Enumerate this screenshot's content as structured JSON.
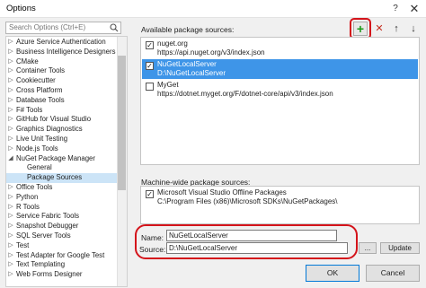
{
  "window": {
    "title": "Options",
    "help_label": "?",
    "close_label": "✕"
  },
  "search": {
    "placeholder": "Search Options (Ctrl+E)"
  },
  "tree": {
    "items": [
      {
        "label": "Azure Service Authentication",
        "expandable": true,
        "level": 0,
        "selected": false
      },
      {
        "label": "Business Intelligence Designers",
        "expandable": true,
        "level": 0,
        "selected": false
      },
      {
        "label": "CMake",
        "expandable": true,
        "level": 0,
        "selected": false
      },
      {
        "label": "Container Tools",
        "expandable": true,
        "level": 0,
        "selected": false
      },
      {
        "label": "Cookiecutter",
        "expandable": true,
        "level": 0,
        "selected": false
      },
      {
        "label": "Cross Platform",
        "expandable": true,
        "level": 0,
        "selected": false
      },
      {
        "label": "Database Tools",
        "expandable": true,
        "level": 0,
        "selected": false
      },
      {
        "label": "F# Tools",
        "expandable": true,
        "level": 0,
        "selected": false
      },
      {
        "label": "GitHub for Visual Studio",
        "expandable": true,
        "level": 0,
        "selected": false
      },
      {
        "label": "Graphics Diagnostics",
        "expandable": true,
        "level": 0,
        "selected": false
      },
      {
        "label": "Live Unit Testing",
        "expandable": true,
        "level": 0,
        "selected": false
      },
      {
        "label": "Node.js Tools",
        "expandable": true,
        "level": 0,
        "selected": false
      },
      {
        "label": "NuGet Package Manager",
        "expandable": true,
        "expanded": true,
        "level": 0,
        "selected": false
      },
      {
        "label": "General",
        "expandable": false,
        "level": 1,
        "selected": false
      },
      {
        "label": "Package Sources",
        "expandable": false,
        "level": 1,
        "selected": true
      },
      {
        "label": "Office Tools",
        "expandable": true,
        "level": 0,
        "selected": false
      },
      {
        "label": "Python",
        "expandable": true,
        "level": 0,
        "selected": false
      },
      {
        "label": "R Tools",
        "expandable": true,
        "level": 0,
        "selected": false
      },
      {
        "label": "Service Fabric Tools",
        "expandable": true,
        "level": 0,
        "selected": false
      },
      {
        "label": "Snapshot Debugger",
        "expandable": true,
        "level": 0,
        "selected": false
      },
      {
        "label": "SQL Server Tools",
        "expandable": true,
        "level": 0,
        "selected": false
      },
      {
        "label": "Test",
        "expandable": true,
        "level": 0,
        "selected": false
      },
      {
        "label": "Test Adapter for Google Test",
        "expandable": true,
        "level": 0,
        "selected": false
      },
      {
        "label": "Text Templating",
        "expandable": true,
        "level": 0,
        "selected": false
      },
      {
        "label": "Web Forms Designer",
        "expandable": true,
        "level": 0,
        "selected": false
      }
    ]
  },
  "available": {
    "label": "Available package sources:",
    "sources": [
      {
        "name": "nuget.org",
        "url": "https://api.nuget.org/v3/index.json",
        "checked": true,
        "selected": false
      },
      {
        "name": "NuGetLocalServer",
        "url": "D:\\NuGetLocalServer",
        "checked": true,
        "selected": true
      },
      {
        "name": "MyGet",
        "url": "https://dotnet.myget.org/F/dotnet-core/api/v3/index.json",
        "checked": false,
        "selected": false
      }
    ]
  },
  "machine": {
    "label": "Machine-wide package sources:",
    "sources": [
      {
        "name": "Microsoft Visual Studio Offline Packages",
        "url": "C:\\Program Files (x86)\\Microsoft SDKs\\NuGetPackages\\",
        "checked": true,
        "selected": false
      }
    ]
  },
  "fields": {
    "name_label": "Name:",
    "name_value": "NuGetLocalServer",
    "source_label": "Source:",
    "source_value": "D:\\NuGetLocalServer",
    "browse_label": "...",
    "update_label": "Update"
  },
  "footer": {
    "ok_label": "OK",
    "cancel_label": "Cancel"
  },
  "colors": {
    "selection": "#3e95e8",
    "tree_selection": "#cce4f7",
    "highlight": "#d4141b",
    "add_green": "#1a9a1a"
  }
}
